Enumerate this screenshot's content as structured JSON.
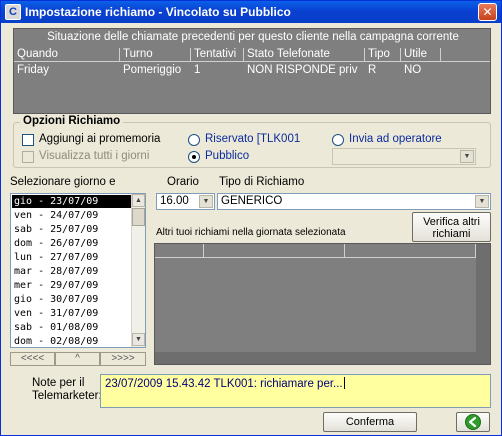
{
  "window": {
    "title": "Impostazione richiamo - Vincolato su Pubblico",
    "app_icon_letter": "C",
    "close_symbol": "✕"
  },
  "history": {
    "caption": "Situazione delle chiamate precedenti per questo cliente nella campagna corrente",
    "columns": [
      "Quando",
      "Turno",
      "Tentativi",
      "Stato Telefonate",
      "Tipo",
      "Utile"
    ],
    "rows": [
      [
        "Friday",
        "Pomeriggio",
        "1",
        "NON RISPONDE priv",
        "R",
        "NO"
      ]
    ]
  },
  "options": {
    "title": "Opzioni Richiamo",
    "add_reminder_label": "Aggiungi ai promemoria",
    "add_reminder_checked": false,
    "show_all_days_label": "Visualizza tutti i giorni",
    "show_all_days_enabled": false,
    "radio_reserved_label": "Riservato [TLK001",
    "radio_public_label": "Pubblico",
    "radio_send_operator_label": "Invia ad operatore",
    "selected_radio": "Pubblico",
    "operator_value": ""
  },
  "day_selector": {
    "label": "Selezionare giorno e",
    "days": [
      "gio - 23/07/09",
      "ven - 24/07/09",
      "sab - 25/07/09",
      "dom - 26/07/09",
      "lun - 27/07/09",
      "mar - 28/07/09",
      "mer - 29/07/09",
      "gio - 30/07/09",
      "ven - 31/07/09",
      "sab - 01/08/09",
      "dom - 02/08/09"
    ],
    "selected_index": 0,
    "nav_prev": "<<<<",
    "nav_mid": "^",
    "nav_next": ">>>>"
  },
  "schedule": {
    "time_label": "Orario",
    "time_value": "16.00",
    "type_label": "Tipo di Richiamo",
    "type_value": "GENERICO",
    "verify_button": "Verifica altri richiami",
    "other_calls_label": "Altri tuoi richiami nella giornata selezionata"
  },
  "notes": {
    "label": "Note per il Telemarketer:",
    "value": "23/07/2009 15.43.42 TLK001: richiamare per..."
  },
  "footer": {
    "confirm_button": "Conferma"
  },
  "colors": {
    "window_bg": "#ece9d8",
    "titlebar": "#0a3fd0",
    "grid_bg": "#7f7f7f",
    "notes_bg": "#ffff9f",
    "selected_day_bg": "#000000",
    "radio_label": "#0b2b9e"
  },
  "icons": {
    "app": "app-logo-icon",
    "close": "close-icon",
    "dropdown": "chevron-down-icon",
    "go": "arrow-left-green-icon"
  }
}
